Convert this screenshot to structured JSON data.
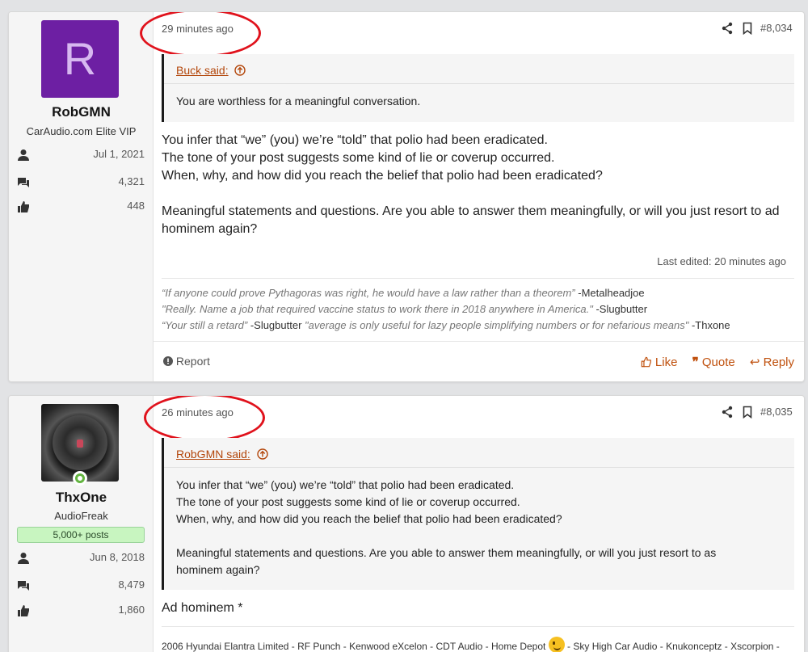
{
  "posts": [
    {
      "avatar_letter": "R",
      "username": "RobGMN",
      "user_title": "CarAudio.com Elite VIP",
      "joined": "Jul 1, 2021",
      "messages": "4,321",
      "reactions": "448",
      "time": "29 minutes ago",
      "post_number": "#8,034",
      "quote_author": "Buck said:",
      "quote_text": "You are worthless for a meaningful conversation.",
      "body_lines": [
        "You infer that “we” (you) we’re “told” that polio had been eradicated.",
        "The tone of your post suggests some kind of lie or coverup occurred.",
        "When, why, and how did you reach the belief that polio had been eradicated?",
        "",
        "Meaningful statements and questions. Are you able to answer them meaningfully, or will you just resort to ad",
        "hominem again?"
      ],
      "last_edited": "Last edited: 20 minutes ago",
      "signature": {
        "line1_quote": "“If anyone could prove Pythagoras was right, he would have a law rather than a theorem”",
        "line1_by": " -Metalheadjoe",
        "line2_quote": "\"Really. Name a job that required vaccine status to work there in 2018 anywhere in America.\"",
        "line2_by": " -Slugbutter",
        "line3_quote_a": "“Your still a retard”",
        "line3_by_a": " -Slugbutter ",
        "line3_quote_b": "\"average is only useful for lazy people simplifying numbers or for nefarious means\"",
        "line3_by_b": " -Thxone"
      },
      "report_label": "Report",
      "like_label": "Like",
      "quote_label": "Quote",
      "reply_label": "Reply"
    },
    {
      "username": "ThxOne",
      "user_title": "AudioFreak",
      "banner": "5,000+ posts",
      "joined": "Jun 8, 2018",
      "messages": "8,479",
      "reactions": "1,860",
      "time": "26 minutes ago",
      "post_number": "#8,035",
      "quote_author": "RobGMN said:",
      "quote_lines": [
        "You infer that “we” (you) we’re “told” that polio had been eradicated.",
        "The tone of your post suggests some kind of lie or coverup occurred.",
        "When, why, and how did you reach the belief that polio had been eradicated?",
        "",
        "Meaningful statements and questions. Are you able to answer them meaningfully, or will you just resort to as",
        "hominem again?"
      ],
      "body": "Ad hominem *",
      "signature_a": "2006 Hyundai Elantra Limited - RF Punch - Kenwood eXcelon - CDT Audio - Home Depot ",
      "signature_b": " - Sky High Car Audio - Knukonceptz - Xscorpion -"
    }
  ],
  "colors": {
    "accent": "#c0510e",
    "highlight_ring": "#e0121c",
    "avatar_bg": "#6d1fa3",
    "online": "#63b440"
  },
  "icons": [
    "user-icon",
    "messages-icon",
    "thumbs-up-icon",
    "share-icon",
    "bookmark-icon",
    "arrow-up-circle-icon",
    "info-icon",
    "wink-emoji-icon"
  ]
}
